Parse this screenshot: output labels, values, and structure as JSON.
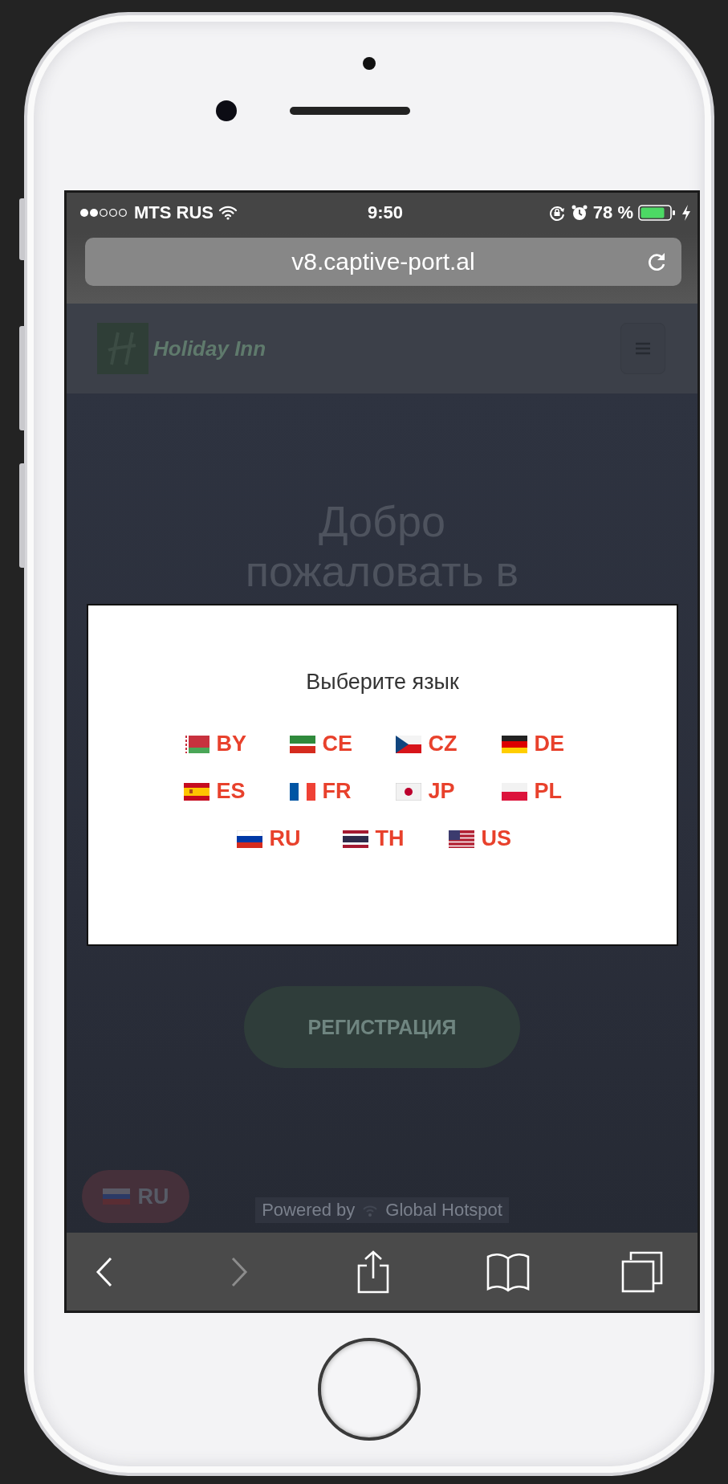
{
  "status_bar": {
    "carrier": "MTS RUS",
    "time": "9:50",
    "battery": "78 %"
  },
  "address_bar": {
    "url": "v8.captive-port.al"
  },
  "site_header": {
    "logo_text": "Holiday Inn"
  },
  "hero": {
    "heading": [
      "Добро",
      "пожаловать в"
    ],
    "register_button": "РЕГИСТРАЦИЯ",
    "language_button": "RU",
    "powered_by": "Powered by",
    "brand": "Global Hotspot"
  },
  "language_dialog": {
    "title": "Выберите язык",
    "languages": [
      {
        "code": "BY",
        "kind": "by"
      },
      {
        "code": "CE",
        "kind": "ce"
      },
      {
        "code": "CZ",
        "kind": "cz"
      },
      {
        "code": "DE",
        "kind": "de"
      },
      {
        "code": "ES",
        "kind": "es"
      },
      {
        "code": "FR",
        "kind": "fr"
      },
      {
        "code": "JP",
        "kind": "jp"
      },
      {
        "code": "PL",
        "kind": "pl"
      },
      {
        "code": "RU",
        "kind": "ru"
      },
      {
        "code": "TH",
        "kind": "th"
      },
      {
        "code": "US",
        "kind": "us"
      }
    ]
  },
  "toolbar": {
    "back": {
      "disabled": false
    },
    "forward": {
      "disabled": true
    }
  }
}
